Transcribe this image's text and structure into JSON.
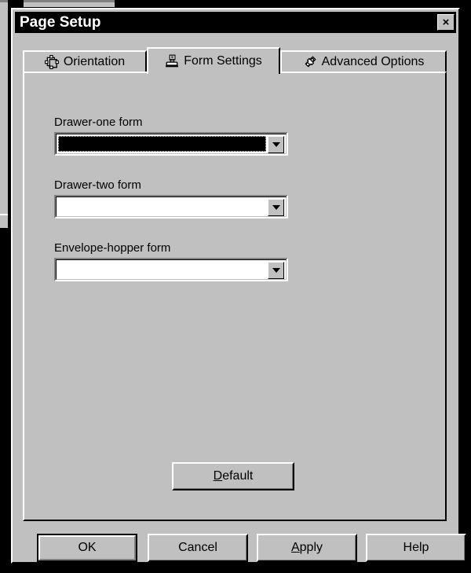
{
  "window": {
    "title": "Page Setup",
    "close_icon": "close-x-icon",
    "close_label": "×"
  },
  "tabs": [
    {
      "id": "orientation",
      "label": "Orientation",
      "icon": "page-orientation-icon",
      "selected": false
    },
    {
      "id": "form-settings",
      "label": "Form Settings",
      "icon": "printer-icon",
      "selected": true
    },
    {
      "id": "advanced-options",
      "label": "Advanced Options",
      "icon": "puzzle-piece-icon",
      "selected": false
    }
  ],
  "form": {
    "fields": [
      {
        "id": "drawer-one",
        "label": "Drawer-one form",
        "value": "",
        "placeholder": "",
        "focused": true,
        "arrow_icon": "chevron-down-icon"
      },
      {
        "id": "drawer-two",
        "label": "Drawer-two form",
        "value": "",
        "placeholder": "",
        "focused": false,
        "arrow_icon": "chevron-down-icon"
      },
      {
        "id": "envelope-hopper",
        "label": "Envelope-hopper form",
        "value": "",
        "placeholder": "",
        "focused": false,
        "arrow_icon": "chevron-down-icon"
      }
    ],
    "default_button": {
      "label": "Default",
      "accel": "D",
      "rest": "efault"
    }
  },
  "buttons": [
    {
      "id": "ok",
      "label": "OK",
      "accel": "",
      "rest": "OK",
      "is_default": true
    },
    {
      "id": "cancel",
      "label": "Cancel",
      "accel": "",
      "rest": "Cancel",
      "is_default": false
    },
    {
      "id": "apply",
      "label": "Apply",
      "accel": "A",
      "rest": "pply",
      "is_default": false
    },
    {
      "id": "help",
      "label": "Help",
      "accel": "",
      "rest": "Help",
      "is_default": false
    }
  ],
  "colors": {
    "face": "#c0c0c0",
    "shadow": "#808080",
    "highlight": "#ffffff",
    "text": "#000000",
    "titlebar": "#000000",
    "titlebar_text": "#ffffff",
    "desktop": "#000000"
  }
}
